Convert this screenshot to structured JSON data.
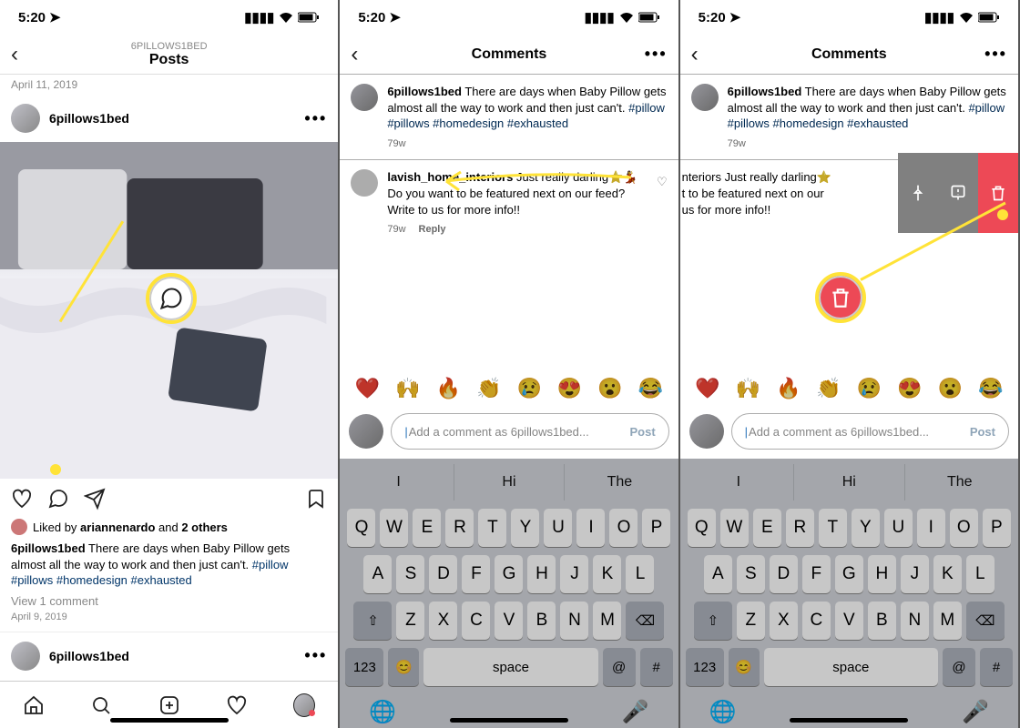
{
  "status": {
    "time": "5:20",
    "location_icon": true
  },
  "phone1": {
    "header": {
      "sub": "6PILLOWS1BED",
      "main": "Posts"
    },
    "top_date": "April 11, 2019",
    "post_user": "6pillows1bed",
    "likes": {
      "prefix": "Liked by ",
      "name": "ariannenardo",
      "mid": " and ",
      "others": "2 others"
    },
    "caption": {
      "user": "6pillows1bed",
      "body": " There are days when Baby Pillow gets almost all the way to work and then just can't. ",
      "tags": "#pillow #pillows #homedesign #exhausted"
    },
    "view_comment": "View 1 comment",
    "post_date": "April 9, 2019",
    "second_user": "6pillows1bed"
  },
  "comments_header": "Comments",
  "owner_comment": {
    "user": "6pillows1bed",
    "body": " There are days when Baby Pillow gets almost all the way to work and then just can't. ",
    "tags": "#pillow #pillows #homedesign #exhausted",
    "age": "79w"
  },
  "reply_comment": {
    "user": "lavish_home_interiors",
    "body": " Just really darling⭐💃 Do you want to be featured next on our feed? Write to us for more info!!",
    "age": "79w",
    "reply": "Reply"
  },
  "reply_comment_partial": {
    "line1": "nteriors Just really darling⭐",
    "line2": "t to be featured next on our",
    "line3": "us for more info!!"
  },
  "emoji_row": [
    "❤️",
    "🙌",
    "🔥",
    "👏",
    "😢",
    "😍",
    "😮",
    "😂"
  ],
  "comment_input": {
    "placeholder": "Add a comment as 6pillows1bed...",
    "post": "Post"
  },
  "predictions": [
    "I",
    "Hi",
    "The"
  ],
  "keys": {
    "r1": [
      "Q",
      "W",
      "E",
      "R",
      "T",
      "Y",
      "U",
      "I",
      "O",
      "P"
    ],
    "r2": [
      "A",
      "S",
      "D",
      "F",
      "G",
      "H",
      "J",
      "K",
      "L"
    ],
    "r3": [
      "Z",
      "X",
      "C",
      "V",
      "B",
      "N",
      "M"
    ],
    "num": "123",
    "space": "space",
    "at": "@",
    "hash": "#"
  }
}
